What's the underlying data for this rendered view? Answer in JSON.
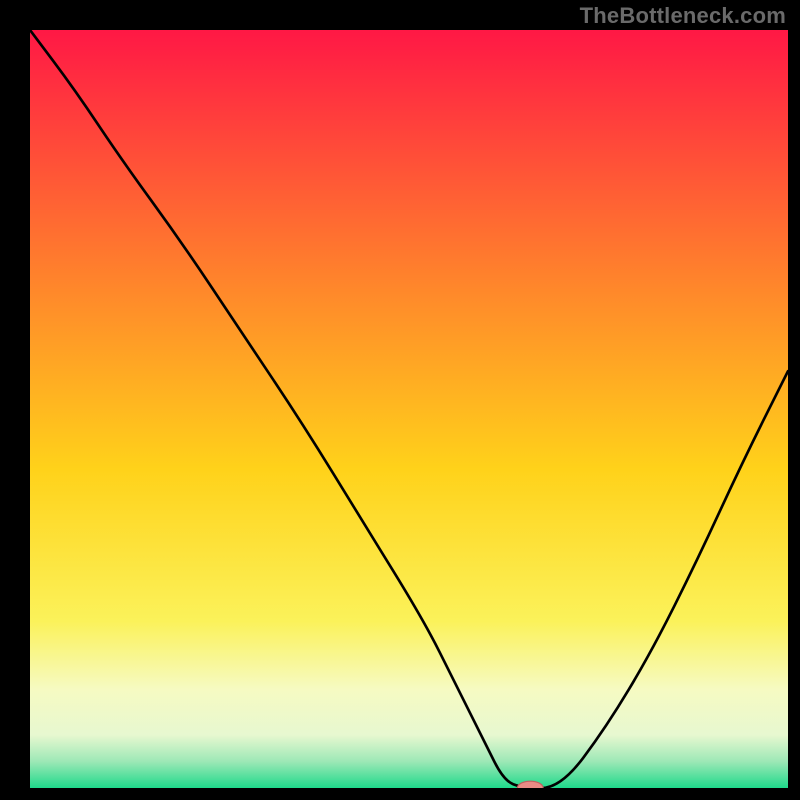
{
  "watermark": "TheBottleneck.com",
  "colors": {
    "page_bg": "#000000",
    "curve": "#000000",
    "marker_fill": "#e98b85",
    "marker_stroke": "#c06060",
    "gradient_stops": [
      {
        "offset": 0.0,
        "color": "#ff1845"
      },
      {
        "offset": 0.35,
        "color": "#ff8a2a"
      },
      {
        "offset": 0.58,
        "color": "#ffd21a"
      },
      {
        "offset": 0.78,
        "color": "#fbf25a"
      },
      {
        "offset": 0.87,
        "color": "#f6fac2"
      },
      {
        "offset": 0.93,
        "color": "#e7f8d0"
      },
      {
        "offset": 0.965,
        "color": "#9de8b6"
      },
      {
        "offset": 1.0,
        "color": "#1fd98b"
      }
    ]
  },
  "chart_data": {
    "type": "line",
    "title": "",
    "xlabel": "",
    "ylabel": "",
    "xlim": [
      0,
      100
    ],
    "ylim": [
      0,
      100
    ],
    "grid": false,
    "legend_position": "none",
    "series": [
      {
        "name": "bottleneck_curve",
        "x": [
          0,
          6,
          12,
          20,
          28,
          36,
          44,
          52,
          56,
          60,
          62.5,
          65,
          70,
          76,
          82,
          88,
          94,
          100
        ],
        "y": [
          100,
          92,
          83,
          72,
          60,
          48,
          35,
          22,
          14,
          6,
          1,
          0,
          0,
          8,
          18,
          30,
          43,
          55
        ]
      }
    ],
    "marker": {
      "x": 66,
      "y": 0,
      "rx": 1.7,
      "ry": 0.9
    },
    "annotations": []
  }
}
